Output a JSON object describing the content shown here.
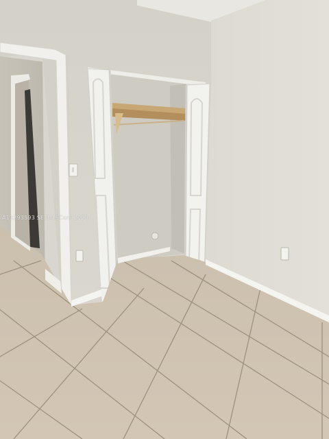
{
  "photo": {
    "subject": "empty bedroom with open bifold closet",
    "watermark_text": "A11293593 SEFMLSCom 2023",
    "colors": {
      "ceiling": "#e7e6e0",
      "right_wall": "#dedcd4",
      "back_wall": "#d6d4cb",
      "left_wall": "#d2cfc6",
      "hallway": "#c9c5bb",
      "closet_interior": "#cfcdc4",
      "closet_shelf": "#c9a872",
      "door_white": "#f2f2ee",
      "floor_tile": "#cdbfae",
      "grout": "#8c8071",
      "baseboard": "#f4f4f1"
    }
  }
}
